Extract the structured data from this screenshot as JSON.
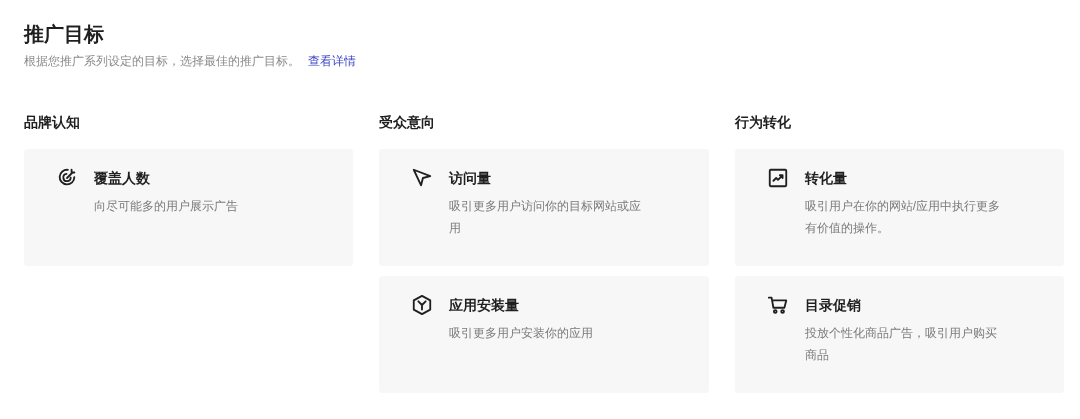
{
  "header": {
    "title": "推广目标",
    "subtitle": "根据您推广系列设定的目标，选择最佳的推广目标。",
    "link": "查看详情"
  },
  "columns": [
    {
      "heading": "品牌认知",
      "cards": [
        {
          "title": "覆盖人数",
          "description": "向尽可能多的用户展示广告"
        }
      ]
    },
    {
      "heading": "受众意向",
      "cards": [
        {
          "title": "访问量",
          "description": "吸引更多用户访问你的目标网站或应用"
        },
        {
          "title": "应用安装量",
          "description": "吸引更多用户安装你的应用"
        }
      ]
    },
    {
      "heading": "行为转化",
      "cards": [
        {
          "title": "转化量",
          "description": "吸引用户在你的网站/应用中执行更多有价值的操作。"
        },
        {
          "title": "目录促销",
          "description": "投放个性化商品广告，吸引用户购买商品"
        }
      ]
    }
  ]
}
